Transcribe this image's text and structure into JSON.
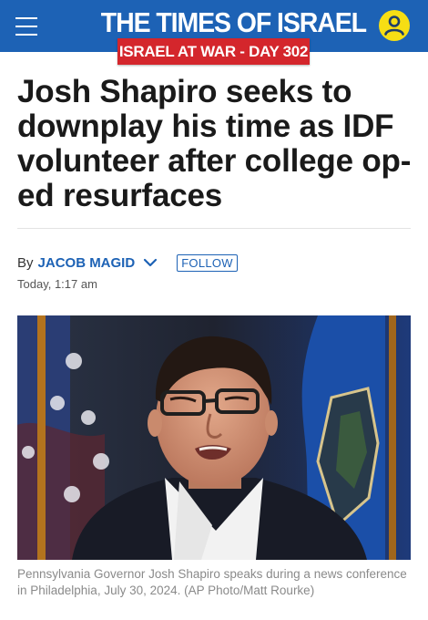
{
  "header": {
    "logo_text": "THE TIMES OF ISRAEL",
    "banner_label": "ISRAEL AT WAR - DAY 302",
    "colors": {
      "header_bg": "#1d62b5",
      "banner_bg": "#d4262c",
      "avatar_bg": "#f6de14"
    },
    "icons": {
      "menu": "hamburger-menu-icon",
      "account": "user-avatar-icon"
    }
  },
  "article": {
    "headline": "Josh Shapiro seeks to downplay his time as IDF volunteer after college op-ed resurfaces",
    "byline": {
      "prefix": "By",
      "author": "JACOB MAGID",
      "follow_label": "FOLLOW",
      "timestamp": "Today, 1:17 am"
    },
    "photo_caption": "Pennsylvania Governor Josh Shapiro speaks during a news conference in Philadelphia, July 30, 2024. (AP Photo/Matt Rourke)"
  }
}
